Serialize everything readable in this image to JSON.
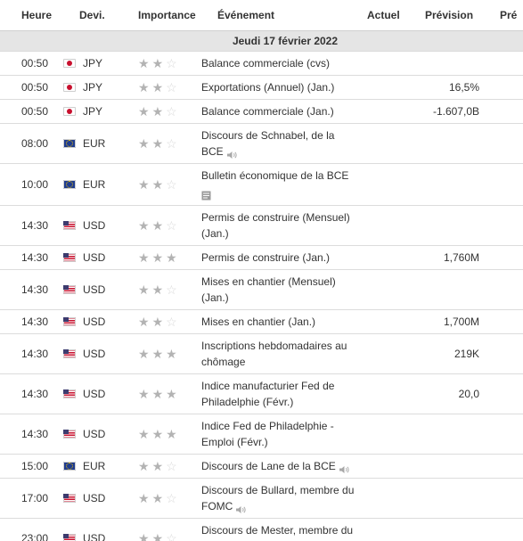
{
  "headers": {
    "heure": "Heure",
    "devise": "Devi.",
    "importance": "Importance",
    "evenement": "Événement",
    "actuel": "Actuel",
    "prevision": "Prévision",
    "precedent": "Pré"
  },
  "date_row": "Jeudi 17 février 2022",
  "rows": [
    {
      "time": "00:50",
      "currency": "JPY",
      "flag": "jp",
      "stars": 2,
      "event": "Balance commerciale (cvs)",
      "icon": "",
      "actual": "",
      "forecast": "",
      "previous": ""
    },
    {
      "time": "00:50",
      "currency": "JPY",
      "flag": "jp",
      "stars": 2,
      "event": "Exportations (Annuel) (Jan.)",
      "icon": "",
      "actual": "",
      "forecast": "16,5%",
      "previous": ""
    },
    {
      "time": "00:50",
      "currency": "JPY",
      "flag": "jp",
      "stars": 2,
      "event": "Balance commerciale (Jan.)",
      "icon": "",
      "actual": "",
      "forecast": "-1.607,0B",
      "previous": ""
    },
    {
      "time": "08:00",
      "currency": "EUR",
      "flag": "eu",
      "stars": 2,
      "event": "Discours de Schnabel, de la BCE",
      "icon": "speaker",
      "actual": "",
      "forecast": "",
      "previous": ""
    },
    {
      "time": "10:00",
      "currency": "EUR",
      "flag": "eu",
      "stars": 2,
      "event": "Bulletin économique de la BCE",
      "icon": "document",
      "actual": "",
      "forecast": "",
      "previous": ""
    },
    {
      "time": "14:30",
      "currency": "USD",
      "flag": "us",
      "stars": 2,
      "event": "Permis de construire (Mensuel) (Jan.)",
      "icon": "",
      "actual": "",
      "forecast": "",
      "previous": ""
    },
    {
      "time": "14:30",
      "currency": "USD",
      "flag": "us",
      "stars": 3,
      "event": "Permis de construire (Jan.)",
      "icon": "",
      "actual": "",
      "forecast": "1,760M",
      "previous": ""
    },
    {
      "time": "14:30",
      "currency": "USD",
      "flag": "us",
      "stars": 2,
      "event": "Mises en chantier (Mensuel) (Jan.)",
      "icon": "",
      "actual": "",
      "forecast": "",
      "previous": ""
    },
    {
      "time": "14:30",
      "currency": "USD",
      "flag": "us",
      "stars": 2,
      "event": "Mises en chantier (Jan.)",
      "icon": "",
      "actual": "",
      "forecast": "1,700M",
      "previous": ""
    },
    {
      "time": "14:30",
      "currency": "USD",
      "flag": "us",
      "stars": 3,
      "event": "Inscriptions hebdomadaires au chômage",
      "icon": "",
      "actual": "",
      "forecast": "219K",
      "previous": ""
    },
    {
      "time": "14:30",
      "currency": "USD",
      "flag": "us",
      "stars": 3,
      "event": "Indice manufacturier Fed de Philadelphie (Févr.)",
      "icon": "",
      "actual": "",
      "forecast": "20,0",
      "previous": ""
    },
    {
      "time": "14:30",
      "currency": "USD",
      "flag": "us",
      "stars": 3,
      "event": "Indice Fed de Philadelphie - Emploi (Févr.)",
      "icon": "",
      "actual": "",
      "forecast": "",
      "previous": ""
    },
    {
      "time": "15:00",
      "currency": "EUR",
      "flag": "eu",
      "stars": 2,
      "event": "Discours de Lane de la BCE",
      "icon": "speaker",
      "actual": "",
      "forecast": "",
      "previous": ""
    },
    {
      "time": "17:00",
      "currency": "USD",
      "flag": "us",
      "stars": 2,
      "event": "Discours de Bullard, membre du FOMC",
      "icon": "speaker",
      "actual": "",
      "forecast": "",
      "previous": ""
    },
    {
      "time": "23:00",
      "currency": "USD",
      "flag": "us",
      "stars": 2,
      "event": "Discours de Mester, membre du FOMC",
      "icon": "speaker",
      "actual": "",
      "forecast": "",
      "previous": ""
    }
  ]
}
